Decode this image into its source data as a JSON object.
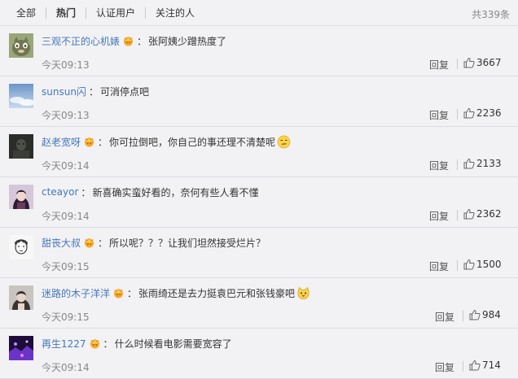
{
  "filter_bar": {
    "tabs": [
      {
        "label": "全部",
        "active": false
      },
      {
        "label": "热门",
        "active": true
      },
      {
        "label": "认证用户",
        "active": false
      },
      {
        "label": "关注的人",
        "active": false
      }
    ],
    "total": "共339条"
  },
  "comments": [
    {
      "user": "三观不正的心机婊",
      "vip": true,
      "text": "张阿姨少蹭热度了",
      "emoji": "",
      "time": "今天09:13",
      "reply": "回复",
      "likes": "3667",
      "avatar": "cat-avatar"
    },
    {
      "user": "sunsun闪",
      "vip": false,
      "text": "可消停点吧",
      "emoji": "",
      "time": "今天09:13",
      "reply": "回复",
      "likes": "2236",
      "avatar": "sky-avatar"
    },
    {
      "user": "赵老宽呀",
      "vip": true,
      "text": "你可拉倒吧，你自己的事还理不清楚呢",
      "emoji": "smirk-emoji-icon",
      "time": "今天09:14",
      "reply": "回复",
      "likes": "2133",
      "avatar": "dark-avatar"
    },
    {
      "user": "cteayor",
      "vip": false,
      "text": "新喜确实蛮好看的，奈何有些人看不懂",
      "emoji": "",
      "time": "今天09:14",
      "reply": "回复",
      "likes": "2362",
      "avatar": "girl-avatar"
    },
    {
      "user": "甜丧大叔",
      "vip": true,
      "text": "所以呢？？？让我们坦然接受烂片？",
      "emoji": "",
      "time": "今天09:15",
      "reply": "回复",
      "likes": "1500",
      "avatar": "sketch-avatar"
    },
    {
      "user": "迷路的木子洋洋",
      "vip": true,
      "text": "张雨绮还是去力挺袁巴元和张钱豪吧",
      "emoji": "cat-emoji-icon",
      "time": "今天09:15",
      "reply": "回复",
      "likes": "984",
      "avatar": "portrait-avatar"
    },
    {
      "user": "再生1227",
      "vip": true,
      "text": "什么时候看电影需要宽容了",
      "emoji": "",
      "time": "今天09:14",
      "reply": "回复",
      "likes": "714",
      "avatar": "purple-avatar"
    }
  ],
  "colors": {
    "username": "#4577b9",
    "background": "#f2f2f5",
    "divider": "#dcdde2",
    "vip_crown": "#f7a823"
  }
}
